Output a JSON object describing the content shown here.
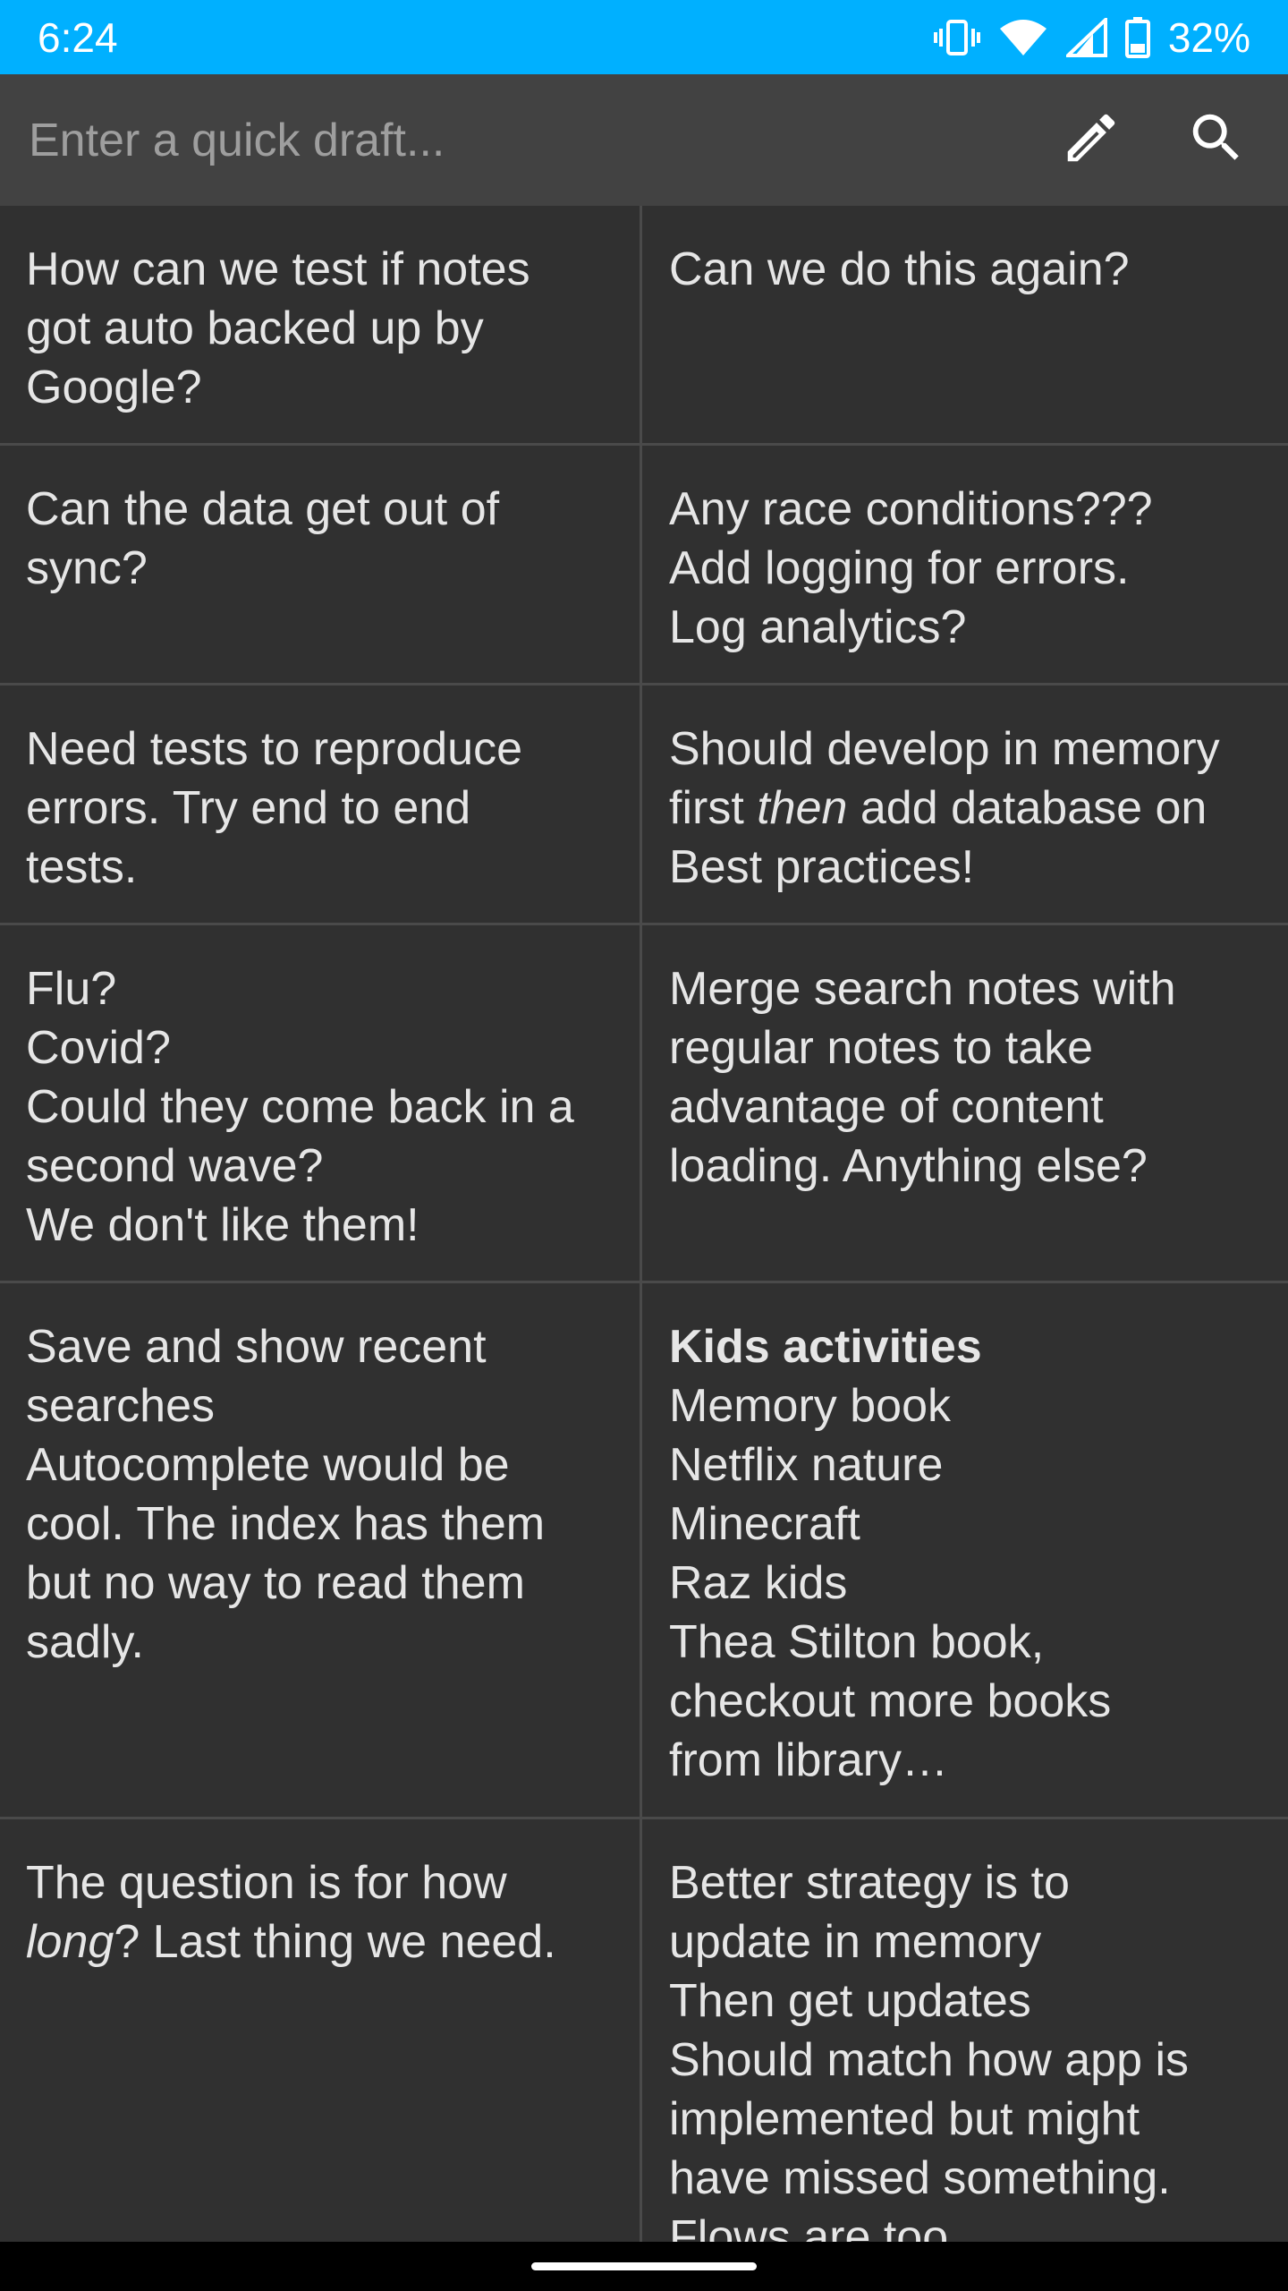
{
  "status_bar": {
    "time": "6:24",
    "battery": "32%",
    "icons": [
      "vibrate-icon",
      "wifi-icon",
      "signal-icon",
      "battery-icon"
    ]
  },
  "draft": {
    "placeholder": "Enter a quick draft...",
    "icons": [
      "pencil-icon",
      "search-icon"
    ]
  },
  "notes": {
    "r0": {
      "left": {
        "l1": "How can we test if notes",
        "l2": "got auto backed up by",
        "l3": "Google?"
      },
      "right": {
        "l1": "Can we do this again?"
      }
    },
    "r1": {
      "left": {
        "l1": "Can the data get out of",
        "l2": "sync?"
      },
      "right": {
        "l1": "Any race conditions???",
        "l2": "Add logging for errors.",
        "l3": "Log analytics?"
      }
    },
    "r2": {
      "left": {
        "l1": "Need tests to reproduce",
        "l2": "errors. Try end to end",
        "l3": "tests."
      },
      "right": {
        "l1": "Should develop in memory",
        "l2a": "first ",
        "l2b": "then",
        "l2c": " add database on",
        "l3": "Best practices!"
      }
    },
    "r3": {
      "left": {
        "l1": "Flu?",
        "l2": "Covid?",
        "l3": "Could they come back in a",
        "l4": "second wave?",
        "l5": "We don't like them!"
      },
      "right": {
        "l1": "Merge search notes with",
        "l2": "regular notes to take",
        "l3": "advantage of content",
        "l4": "loading. Anything else?"
      }
    },
    "r4": {
      "left": {
        "l1": "Save and show recent",
        "l2": "searches",
        "l3": "Autocomplete would be",
        "l4": "cool. The index has them",
        "l5": "but no way to read them",
        "l6": "sadly."
      },
      "right": {
        "title": "Kids activities",
        "l1": "Memory book",
        "l2": "Netflix nature",
        "l3": "Minecraft",
        "l4": "Raz kids",
        "l5": "Thea Stilton book,",
        "l6": "checkout more books",
        "l7": "from library…"
      }
    },
    "r5": {
      "left": {
        "l1": "The question is for how",
        "l2a": "long",
        "l2b": "? Last thing we need."
      },
      "right": {
        "l1": "Better strategy is to",
        "l2": "update in memory",
        "l3": "Then get updates",
        "l4": "Should match how app is",
        "l5": "implemented but might",
        "l6": "have missed something.",
        "l7": "Flows are too"
      }
    }
  },
  "colors": {
    "status_bar": "#00b0ff",
    "background": "#303030",
    "draft_bar": "#424242",
    "divider": "#4a4a4a",
    "text": "#e6e6e6"
  }
}
